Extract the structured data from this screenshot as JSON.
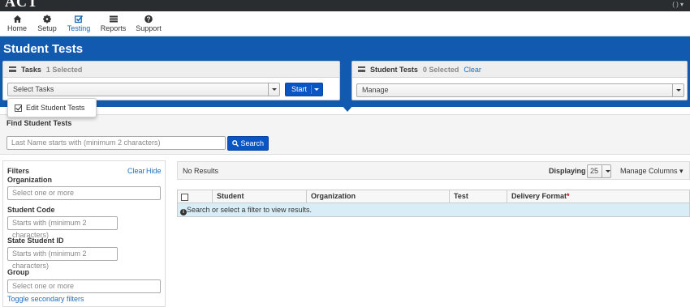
{
  "header": {
    "logo": "ACT",
    "user_menu": "(  )  ▾"
  },
  "nav": [
    {
      "label": "Home",
      "icon": "home-icon"
    },
    {
      "label": "Setup",
      "icon": "gear-icon"
    },
    {
      "label": "Testing",
      "icon": "checkbox-icon",
      "active": true
    },
    {
      "label": "Reports",
      "icon": "report-icon"
    },
    {
      "label": "Support",
      "icon": "help-icon"
    }
  ],
  "page": {
    "title": "Student Tests"
  },
  "tasks_panel": {
    "title": "Tasks",
    "selected": "1 Selected",
    "select_placeholder": "Select Tasks",
    "start_label": "Start",
    "dropdown_items": [
      {
        "label": "Edit Student Tests",
        "checked": true
      }
    ]
  },
  "tests_panel": {
    "title": "Student Tests",
    "selected": "0 Selected",
    "clear_label": "Clear",
    "manage_label": "Manage"
  },
  "find": {
    "title": "Find Student Tests",
    "placeholder": "Last Name starts with (minimum 2 characters)",
    "search_label": "Search"
  },
  "filters": {
    "title": "Filters",
    "clear_label": "Clear",
    "hide_label": "Hide",
    "organization_label": "Organization",
    "organization_placeholder": "Select one or more",
    "student_code_label": "Student Code",
    "student_code_placeholder": "Starts with (minimum 2 characters)",
    "state_id_label": "State Student ID",
    "state_id_placeholder": "Starts with (minimum 2 characters)",
    "group_label": "Group",
    "group_placeholder": "Select one or more",
    "toggle_label": "Toggle secondary filters"
  },
  "results": {
    "status": "No Results",
    "displaying_label": "Displaying",
    "page_size": "25",
    "manage_columns_label": "Manage Columns",
    "columns": [
      "Student",
      "Organization",
      "Test",
      "Delivery Format"
    ],
    "required_mark": "*",
    "empty_message": "Search or select a filter to view results."
  },
  "colors": {
    "brand_blue": "#1259b0",
    "button_blue": "#0a55c4",
    "link": "#1e6fc1",
    "info_row": "#d9edf7"
  }
}
